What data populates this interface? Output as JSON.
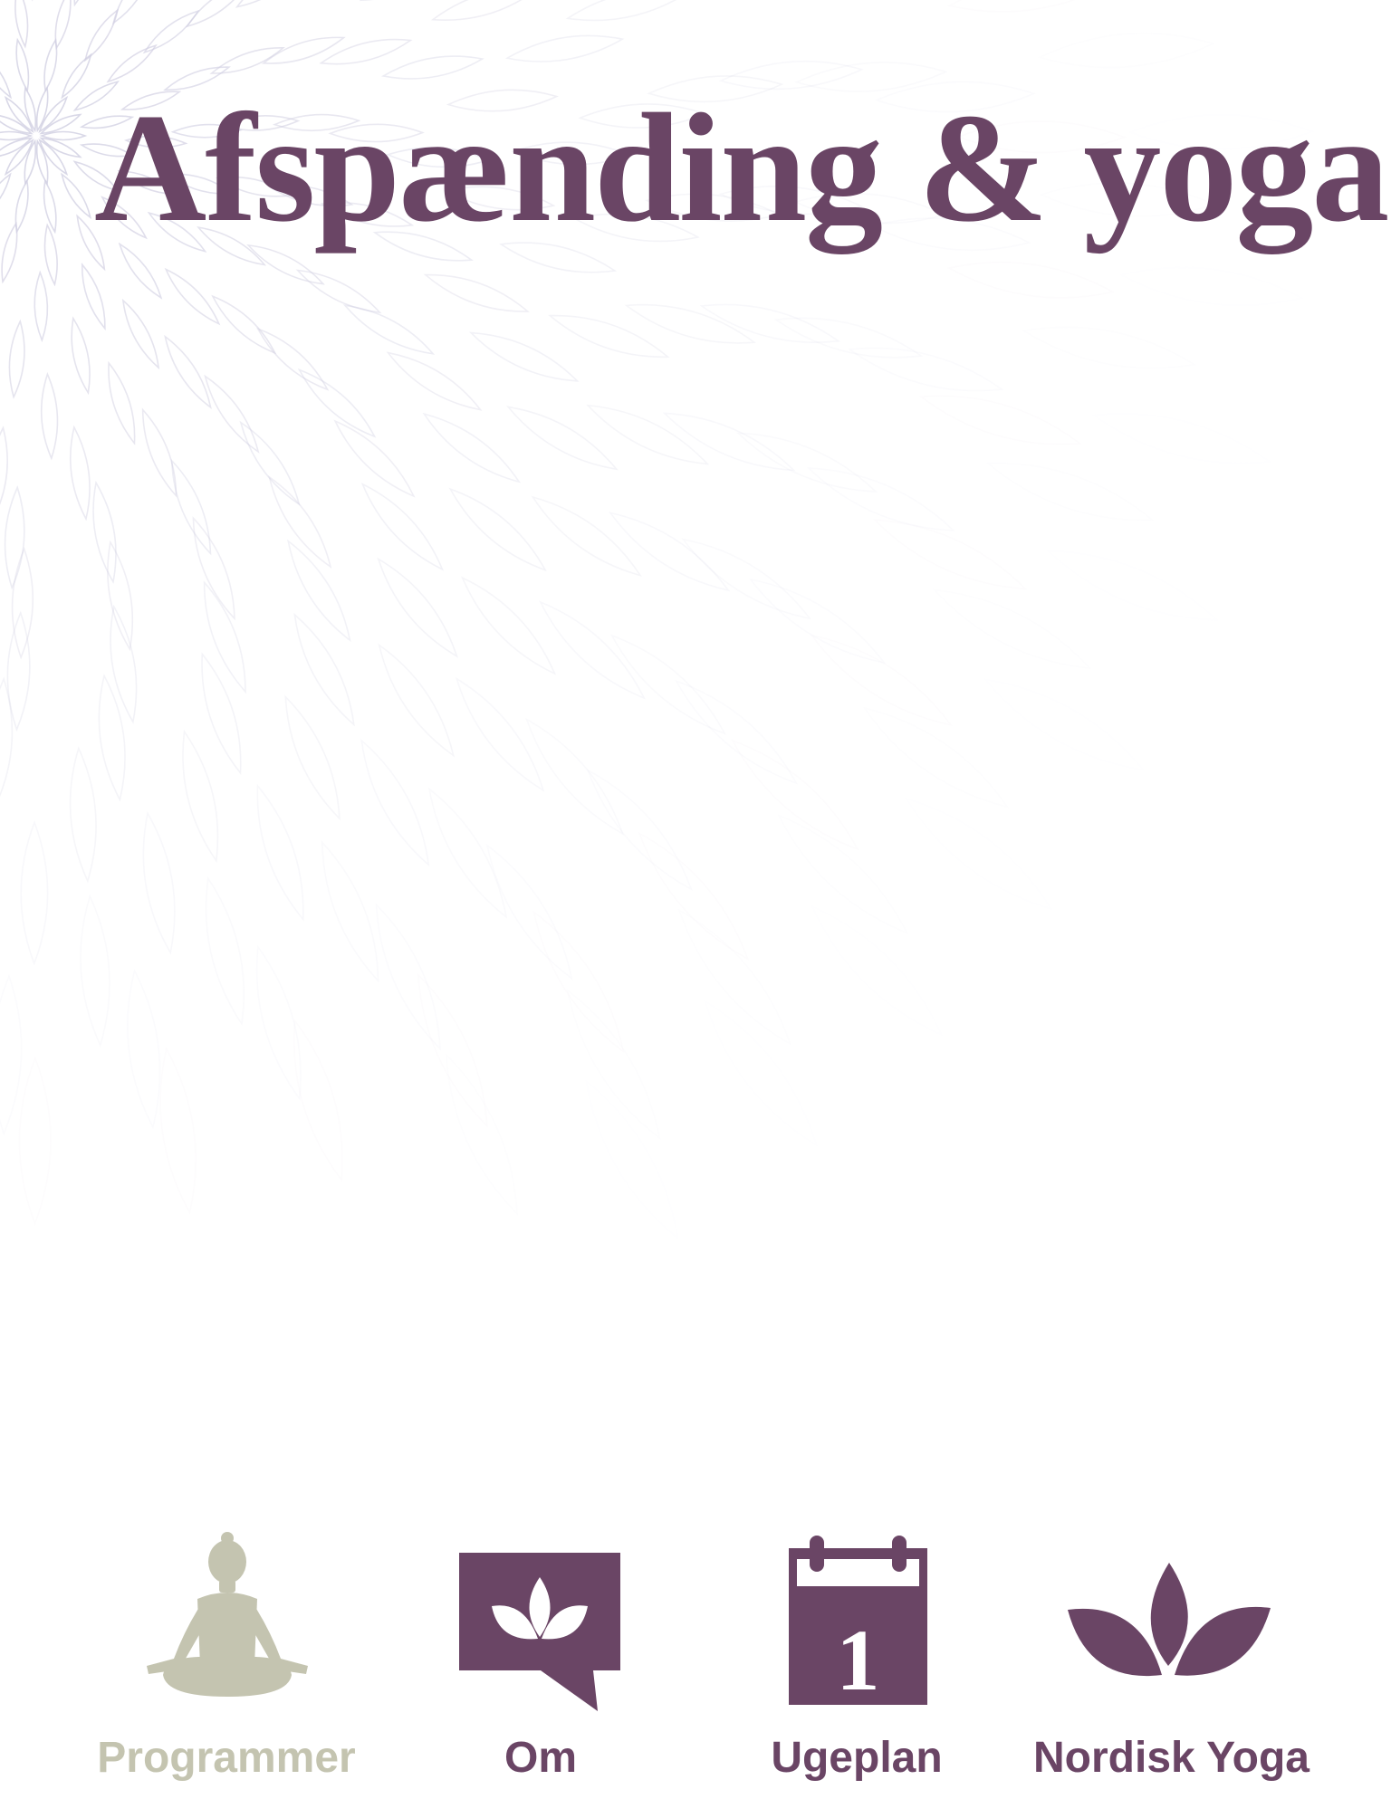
{
  "app": {
    "title": "Afspænding & yoga"
  },
  "colors": {
    "brand_purple": "#6a4565",
    "inactive_gray": "#c4c4b0",
    "pattern_stroke": "#cfcde0",
    "background": "#ffffff"
  },
  "tabs": [
    {
      "label": "Programmer",
      "icon": "meditation-figure-icon",
      "active": true
    },
    {
      "label": "Om",
      "icon": "speech-bubble-lotus-icon",
      "active": false
    },
    {
      "label": "Ugeplan",
      "icon": "calendar-icon",
      "active": false,
      "icon_text": "1"
    },
    {
      "label": "Nordisk Yoga",
      "icon": "lotus-icon",
      "active": false
    }
  ]
}
